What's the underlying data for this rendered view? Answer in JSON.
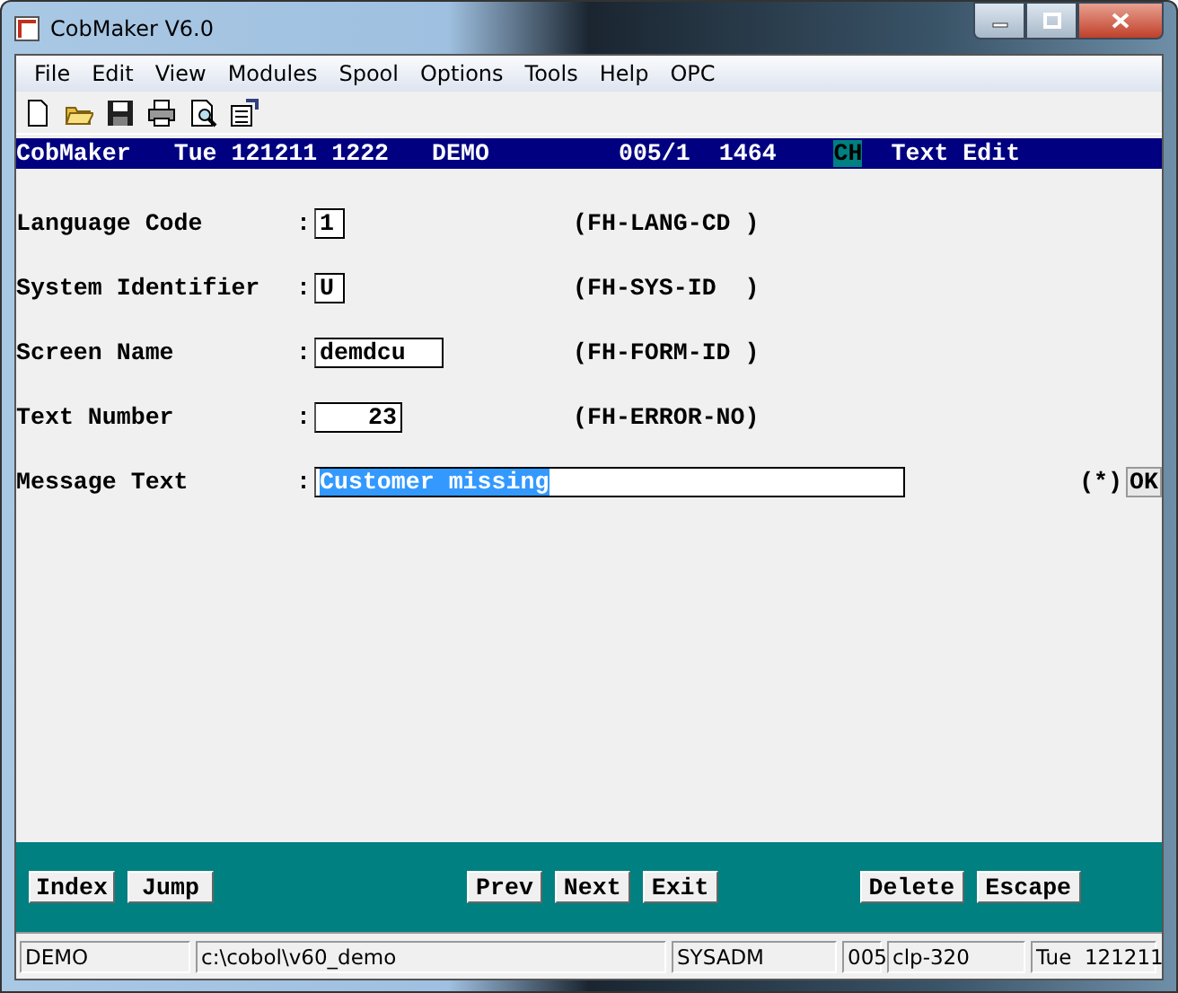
{
  "window": {
    "title": "CobMaker V6.0"
  },
  "menu": [
    "File",
    "Edit",
    "View",
    "Modules",
    "Spool",
    "Options",
    "Tools",
    "Help",
    "OPC"
  ],
  "header": {
    "app": "CobMaker",
    "date": "Tue 121211 1222",
    "user": "DEMO",
    "screen": "005/1",
    "number": "1464",
    "lang": "CH",
    "mode": "Text Edit"
  },
  "fields": [
    {
      "label": "Language Code",
      "colon": ":",
      "value": "1",
      "kind": "short",
      "field_id": "(FH-LANG-CD )",
      "selected": false
    },
    {
      "label": "System Identifier",
      "colon": ":",
      "value": "U",
      "kind": "short",
      "field_id": "(FH-SYS-ID  )",
      "selected": false
    },
    {
      "label": "Screen Name",
      "colon": ":",
      "value": "demdcu",
      "kind": "medium",
      "field_id": "(FH-FORM-ID )",
      "selected": false
    },
    {
      "label": "Text Number",
      "colon": ":",
      "value": "23",
      "kind": "number",
      "field_id": "(FH-ERROR-NO)",
      "selected": false
    },
    {
      "label": "Message Text",
      "colon": ":",
      "value": "Customer missing",
      "kind": "long",
      "selected": true
    }
  ],
  "ok_hint": {
    "marker": "(*)",
    "label": "OK"
  },
  "button_groups": [
    [
      "Index",
      "Jump"
    ],
    [
      "Prev",
      "Next",
      "Exit"
    ],
    [
      "Delete",
      "Escape"
    ]
  ],
  "status_bar": [
    "DEMO",
    "c:\\cobol\\v60_demo",
    "SYSADM",
    "005",
    "clp-320",
    "Tue  121211"
  ]
}
